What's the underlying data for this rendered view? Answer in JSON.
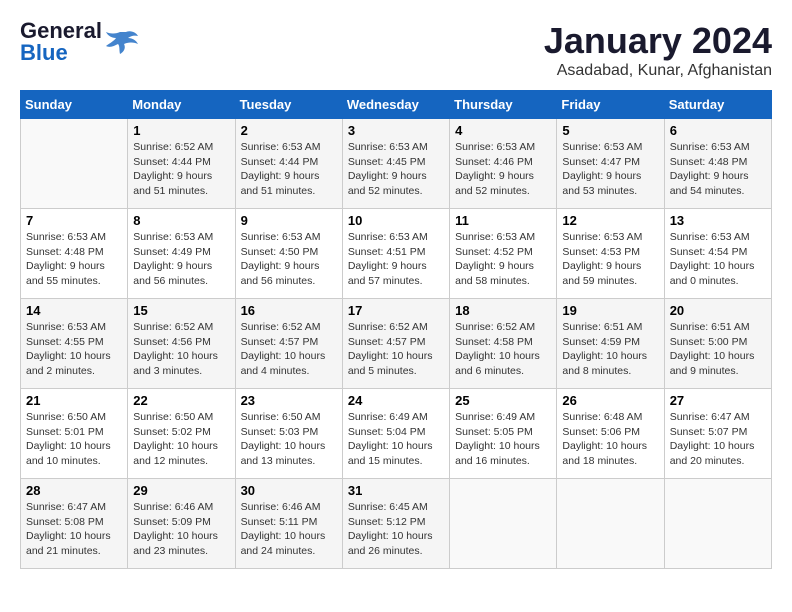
{
  "header": {
    "logo_line1": "General",
    "logo_line2": "Blue",
    "month_title": "January 2024",
    "subtitle": "Asadabad, Kunar, Afghanistan"
  },
  "days_of_week": [
    "Sunday",
    "Monday",
    "Tuesday",
    "Wednesday",
    "Thursday",
    "Friday",
    "Saturday"
  ],
  "weeks": [
    [
      {
        "num": "",
        "info": ""
      },
      {
        "num": "1",
        "info": "Sunrise: 6:52 AM\nSunset: 4:44 PM\nDaylight: 9 hours\nand 51 minutes."
      },
      {
        "num": "2",
        "info": "Sunrise: 6:53 AM\nSunset: 4:44 PM\nDaylight: 9 hours\nand 51 minutes."
      },
      {
        "num": "3",
        "info": "Sunrise: 6:53 AM\nSunset: 4:45 PM\nDaylight: 9 hours\nand 52 minutes."
      },
      {
        "num": "4",
        "info": "Sunrise: 6:53 AM\nSunset: 4:46 PM\nDaylight: 9 hours\nand 52 minutes."
      },
      {
        "num": "5",
        "info": "Sunrise: 6:53 AM\nSunset: 4:47 PM\nDaylight: 9 hours\nand 53 minutes."
      },
      {
        "num": "6",
        "info": "Sunrise: 6:53 AM\nSunset: 4:48 PM\nDaylight: 9 hours\nand 54 minutes."
      }
    ],
    [
      {
        "num": "7",
        "info": "Sunrise: 6:53 AM\nSunset: 4:48 PM\nDaylight: 9 hours\nand 55 minutes."
      },
      {
        "num": "8",
        "info": "Sunrise: 6:53 AM\nSunset: 4:49 PM\nDaylight: 9 hours\nand 56 minutes."
      },
      {
        "num": "9",
        "info": "Sunrise: 6:53 AM\nSunset: 4:50 PM\nDaylight: 9 hours\nand 56 minutes."
      },
      {
        "num": "10",
        "info": "Sunrise: 6:53 AM\nSunset: 4:51 PM\nDaylight: 9 hours\nand 57 minutes."
      },
      {
        "num": "11",
        "info": "Sunrise: 6:53 AM\nSunset: 4:52 PM\nDaylight: 9 hours\nand 58 minutes."
      },
      {
        "num": "12",
        "info": "Sunrise: 6:53 AM\nSunset: 4:53 PM\nDaylight: 9 hours\nand 59 minutes."
      },
      {
        "num": "13",
        "info": "Sunrise: 6:53 AM\nSunset: 4:54 PM\nDaylight: 10 hours\nand 0 minutes."
      }
    ],
    [
      {
        "num": "14",
        "info": "Sunrise: 6:53 AM\nSunset: 4:55 PM\nDaylight: 10 hours\nand 2 minutes."
      },
      {
        "num": "15",
        "info": "Sunrise: 6:52 AM\nSunset: 4:56 PM\nDaylight: 10 hours\nand 3 minutes."
      },
      {
        "num": "16",
        "info": "Sunrise: 6:52 AM\nSunset: 4:57 PM\nDaylight: 10 hours\nand 4 minutes."
      },
      {
        "num": "17",
        "info": "Sunrise: 6:52 AM\nSunset: 4:57 PM\nDaylight: 10 hours\nand 5 minutes."
      },
      {
        "num": "18",
        "info": "Sunrise: 6:52 AM\nSunset: 4:58 PM\nDaylight: 10 hours\nand 6 minutes."
      },
      {
        "num": "19",
        "info": "Sunrise: 6:51 AM\nSunset: 4:59 PM\nDaylight: 10 hours\nand 8 minutes."
      },
      {
        "num": "20",
        "info": "Sunrise: 6:51 AM\nSunset: 5:00 PM\nDaylight: 10 hours\nand 9 minutes."
      }
    ],
    [
      {
        "num": "21",
        "info": "Sunrise: 6:50 AM\nSunset: 5:01 PM\nDaylight: 10 hours\nand 10 minutes."
      },
      {
        "num": "22",
        "info": "Sunrise: 6:50 AM\nSunset: 5:02 PM\nDaylight: 10 hours\nand 12 minutes."
      },
      {
        "num": "23",
        "info": "Sunrise: 6:50 AM\nSunset: 5:03 PM\nDaylight: 10 hours\nand 13 minutes."
      },
      {
        "num": "24",
        "info": "Sunrise: 6:49 AM\nSunset: 5:04 PM\nDaylight: 10 hours\nand 15 minutes."
      },
      {
        "num": "25",
        "info": "Sunrise: 6:49 AM\nSunset: 5:05 PM\nDaylight: 10 hours\nand 16 minutes."
      },
      {
        "num": "26",
        "info": "Sunrise: 6:48 AM\nSunset: 5:06 PM\nDaylight: 10 hours\nand 18 minutes."
      },
      {
        "num": "27",
        "info": "Sunrise: 6:47 AM\nSunset: 5:07 PM\nDaylight: 10 hours\nand 20 minutes."
      }
    ],
    [
      {
        "num": "28",
        "info": "Sunrise: 6:47 AM\nSunset: 5:08 PM\nDaylight: 10 hours\nand 21 minutes."
      },
      {
        "num": "29",
        "info": "Sunrise: 6:46 AM\nSunset: 5:09 PM\nDaylight: 10 hours\nand 23 minutes."
      },
      {
        "num": "30",
        "info": "Sunrise: 6:46 AM\nSunset: 5:11 PM\nDaylight: 10 hours\nand 24 minutes."
      },
      {
        "num": "31",
        "info": "Sunrise: 6:45 AM\nSunset: 5:12 PM\nDaylight: 10 hours\nand 26 minutes."
      },
      {
        "num": "",
        "info": ""
      },
      {
        "num": "",
        "info": ""
      },
      {
        "num": "",
        "info": ""
      }
    ]
  ]
}
